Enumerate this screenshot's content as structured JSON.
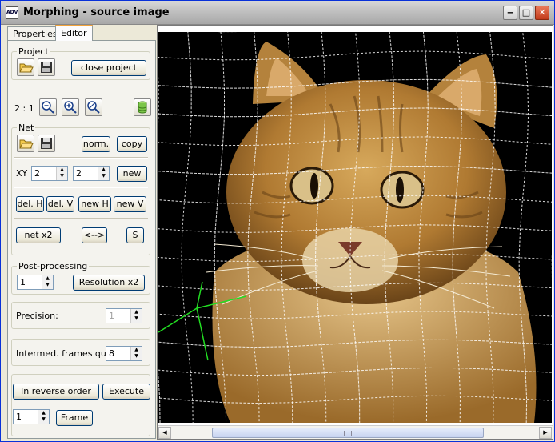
{
  "window": {
    "icon_text": "ADV",
    "title": "Morphing - source image",
    "minimize_glyph": "‒",
    "maximize_glyph": "□",
    "close_glyph": "✕"
  },
  "tabs": {
    "properties": "Properties",
    "editor": "Editor"
  },
  "project": {
    "group_label": "Project",
    "close_label": "close project",
    "zoom_level": "2 : 1"
  },
  "net": {
    "group_label": "Net",
    "norm_label": "norm.",
    "copy_label": "copy",
    "xy_label": "XY",
    "x_value": "2",
    "y_value": "2",
    "new_label": "new",
    "del_h_label": "del. H",
    "del_v_label": "del. V",
    "new_h_label": "new H",
    "new_v_label": "new V",
    "net_x2_label": "net x2",
    "swap_label": "<-->",
    "s_label": "S"
  },
  "postprocessing": {
    "group_label": "Post-processing",
    "value": "1",
    "resolution_label": "Resolution x2"
  },
  "precision": {
    "label": "Precision:",
    "value": "1"
  },
  "intermed": {
    "label": "Intermed. frames quant.",
    "value": "8"
  },
  "actions": {
    "reverse_label": "In reverse order",
    "execute_label": "Execute",
    "frame_value": "1",
    "frame_label": "Frame"
  },
  "icons": {
    "open": "folder-open-icon",
    "save": "floppy-disk-icon",
    "zoom_out": "zoom-out-icon",
    "zoom_in": "zoom-in-icon",
    "zoom_reset": "zoom-reset-icon",
    "database": "database-icon"
  },
  "colors": {
    "mesh_line": "#ffffff",
    "selected_mesh_line": "#22dd22",
    "fur": "#b9893f",
    "background": "#000000"
  }
}
